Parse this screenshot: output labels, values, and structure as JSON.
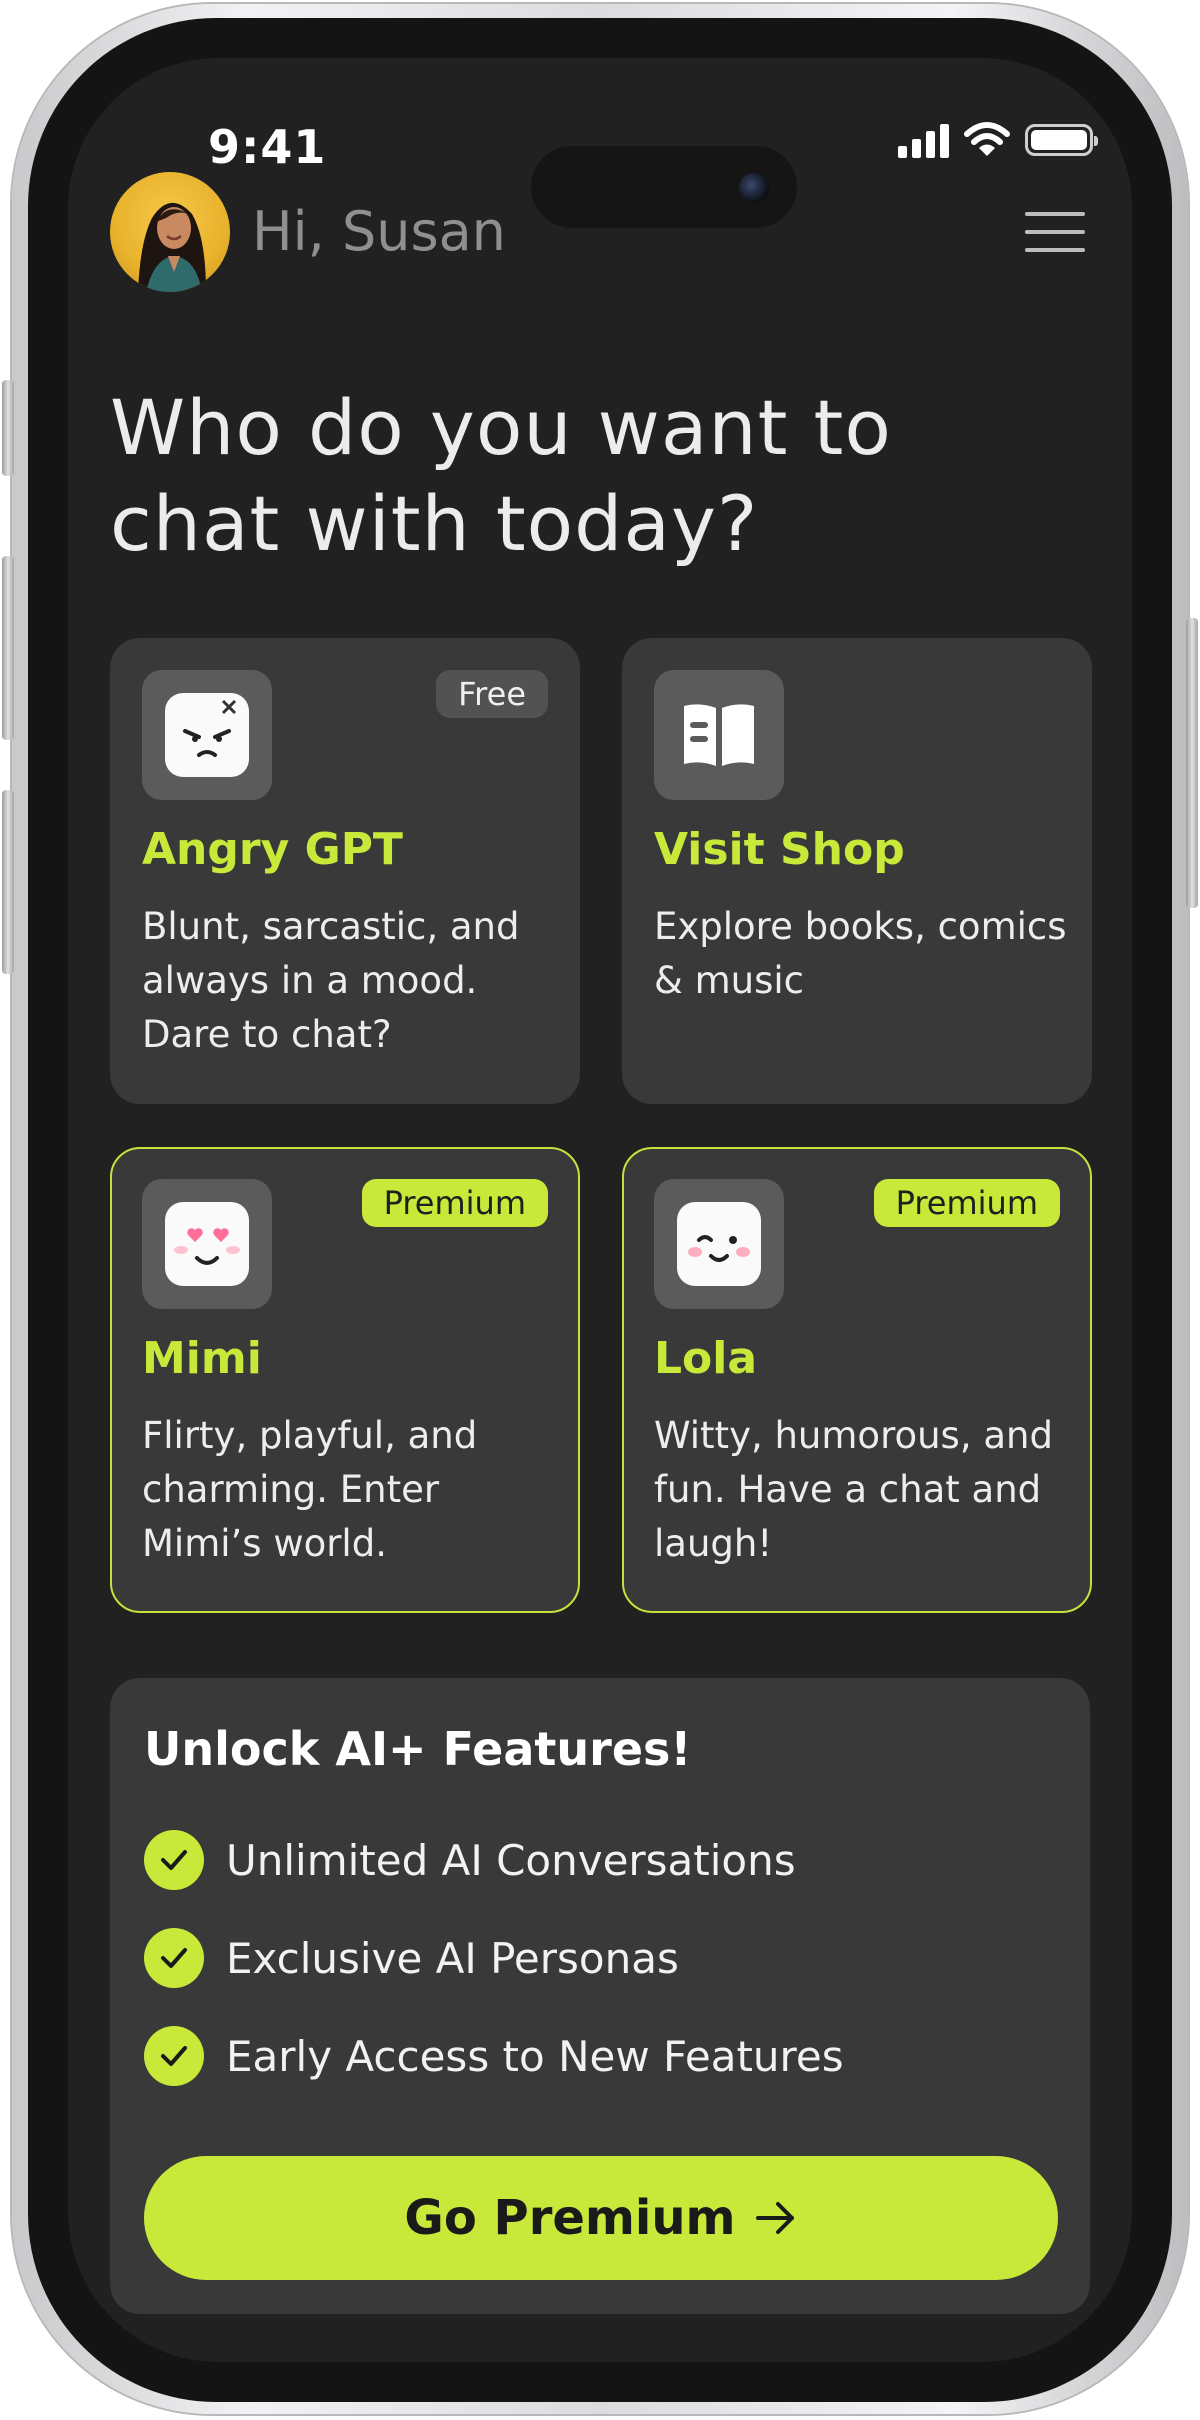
{
  "status_bar": {
    "time": "9:41"
  },
  "header": {
    "greeting": "Hi, Susan"
  },
  "headline": "Who do you want to chat with today?",
  "cards": [
    {
      "badge": "Free",
      "title": "Angry GPT",
      "description": "Blunt, sarcastic, and always in a mood. Dare to chat?",
      "icon": "angry-face-icon"
    },
    {
      "badge": "",
      "title": "Visit Shop",
      "description": "Explore books, comics & music",
      "icon": "book-icon"
    },
    {
      "badge": "Premium",
      "title": "Mimi",
      "description": "Flirty, playful, and charming. Enter Mimi’s world.",
      "icon": "heart-eyes-face-icon"
    },
    {
      "badge": "Premium",
      "title": "Lola",
      "description": "Witty, humorous, and fun. Have a chat and laugh!",
      "icon": "winking-face-icon"
    }
  ],
  "promo": {
    "title": "Unlock AI+ Features!",
    "features": [
      "Unlimited AI Conversations",
      "Exclusive AI Personas",
      "Early Access to New Features"
    ],
    "cta_label": "Go Premium"
  },
  "colors": {
    "accent": "#c8e83a",
    "background": "#212121",
    "card": "#393939"
  }
}
